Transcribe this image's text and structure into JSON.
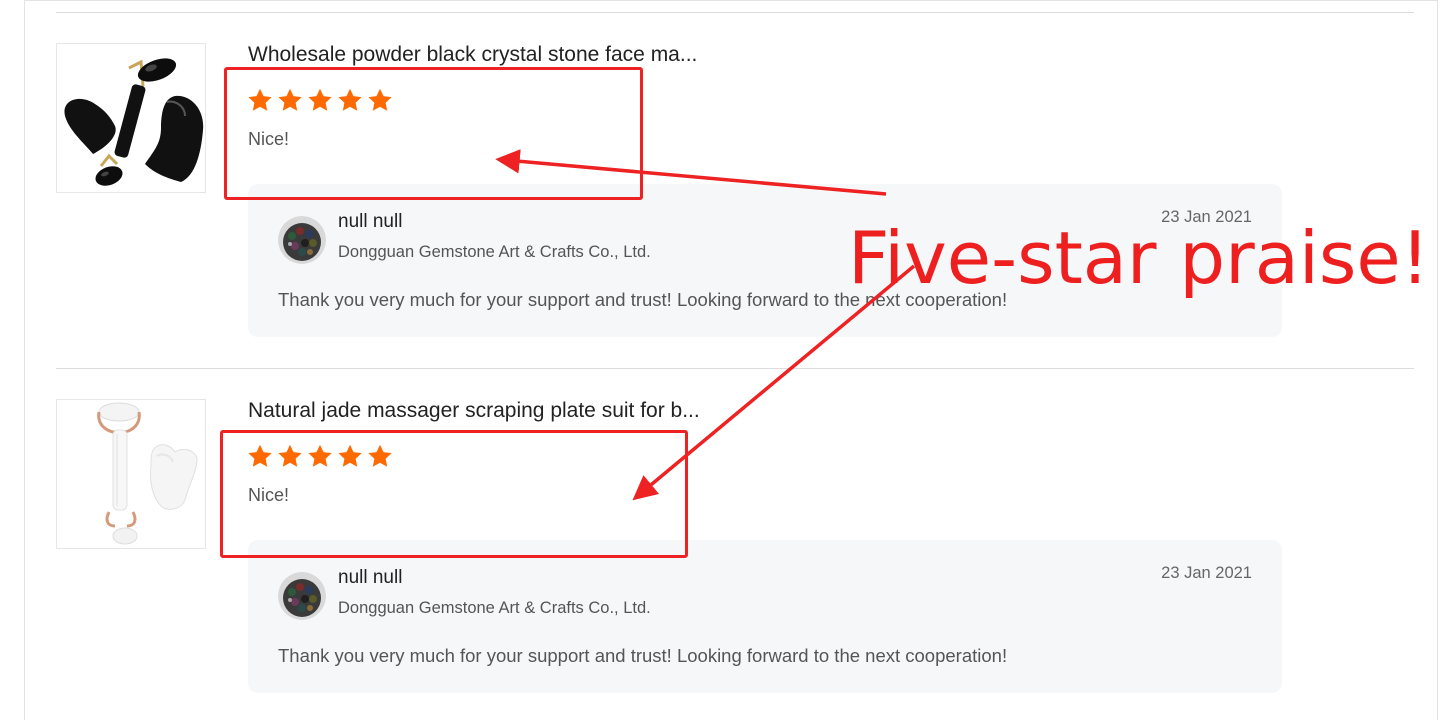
{
  "reviews": [
    {
      "product_title": "Wholesale powder black crystal stone face ma...",
      "rating": 5,
      "rating_max": 5,
      "comment": "Nice!",
      "reply": {
        "name": "null null",
        "company": "Dongguan Gemstone Art & Crafts Co., Ltd.",
        "date": "23 Jan 2021",
        "text": "Thank you very much for your support and trust! Looking forward to the next cooperation!"
      }
    },
    {
      "product_title": "Natural jade massager scraping plate suit for b...",
      "rating": 5,
      "rating_max": 5,
      "comment": "Nice!",
      "reply": {
        "name": "null null",
        "company": "Dongguan Gemstone Art & Crafts Co., Ltd.",
        "date": "23 Jan 2021",
        "text": "Thank you very much for your support and trust! Looking forward to the next cooperation!"
      }
    }
  ],
  "annotation": {
    "text": "Five-star praise!",
    "color": "#ee1f1f"
  },
  "colors": {
    "star": "#ff6a00",
    "reply_bg": "#f6f7f9",
    "annotation": "#ee2222"
  }
}
